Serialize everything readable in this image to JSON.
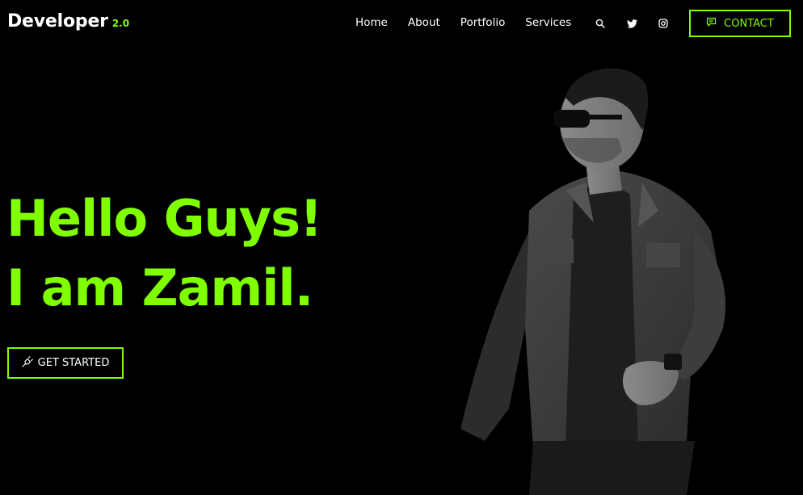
{
  "header": {
    "logo_text": "Developer",
    "logo_version": "2.0",
    "nav": [
      {
        "label": "Home"
      },
      {
        "label": "About"
      },
      {
        "label": "Portfolio"
      },
      {
        "label": "Services"
      }
    ],
    "icons": [
      "search-icon",
      "twitter-icon",
      "instagram-icon"
    ],
    "contact_label": "CONTACT"
  },
  "hero": {
    "line1": "Hello Guys!",
    "line2": "I am Zamil.",
    "cta_label": "GET STARTED"
  },
  "colors": {
    "accent": "#7fff00",
    "background": "#000000",
    "text": "#ffffff"
  }
}
